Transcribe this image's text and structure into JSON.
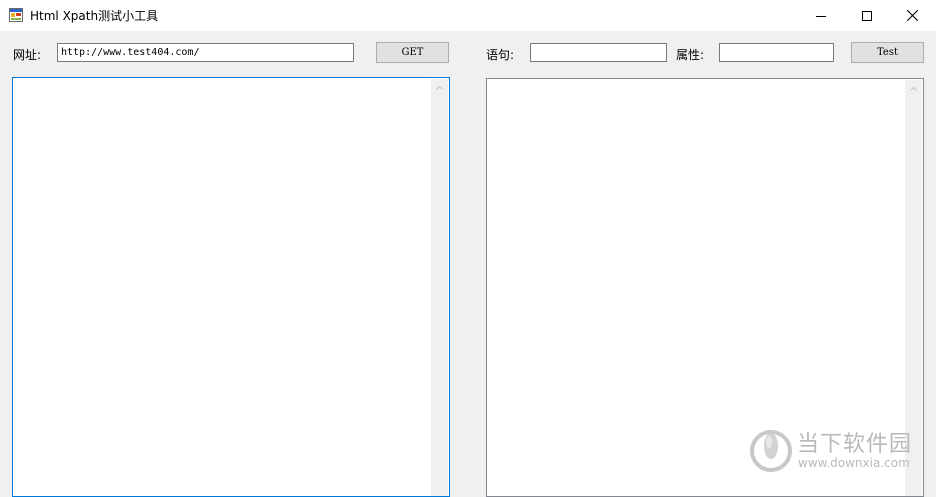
{
  "window": {
    "title": "Html Xpath测试小工具",
    "controls": [
      "minimize-icon",
      "maximize-icon",
      "close-icon"
    ]
  },
  "left_panel": {
    "url_label": "网址:",
    "url_value": "http://www.test404.com/",
    "get_button": "GET",
    "output_text": ""
  },
  "right_panel": {
    "statement_label": "语句:",
    "statement_value": "",
    "attribute_label": "属性:",
    "attribute_value": "",
    "test_button": "Test",
    "output_text": ""
  },
  "watermark": {
    "name": "当下软件园",
    "url": "www.downxia.com"
  },
  "colors": {
    "window_bg": "#f0f0f0",
    "titlebar_bg": "#ffffff",
    "active_border": "#0078d7",
    "button_bg": "#e1e1e1",
    "watermark": "#b9b9b9"
  }
}
